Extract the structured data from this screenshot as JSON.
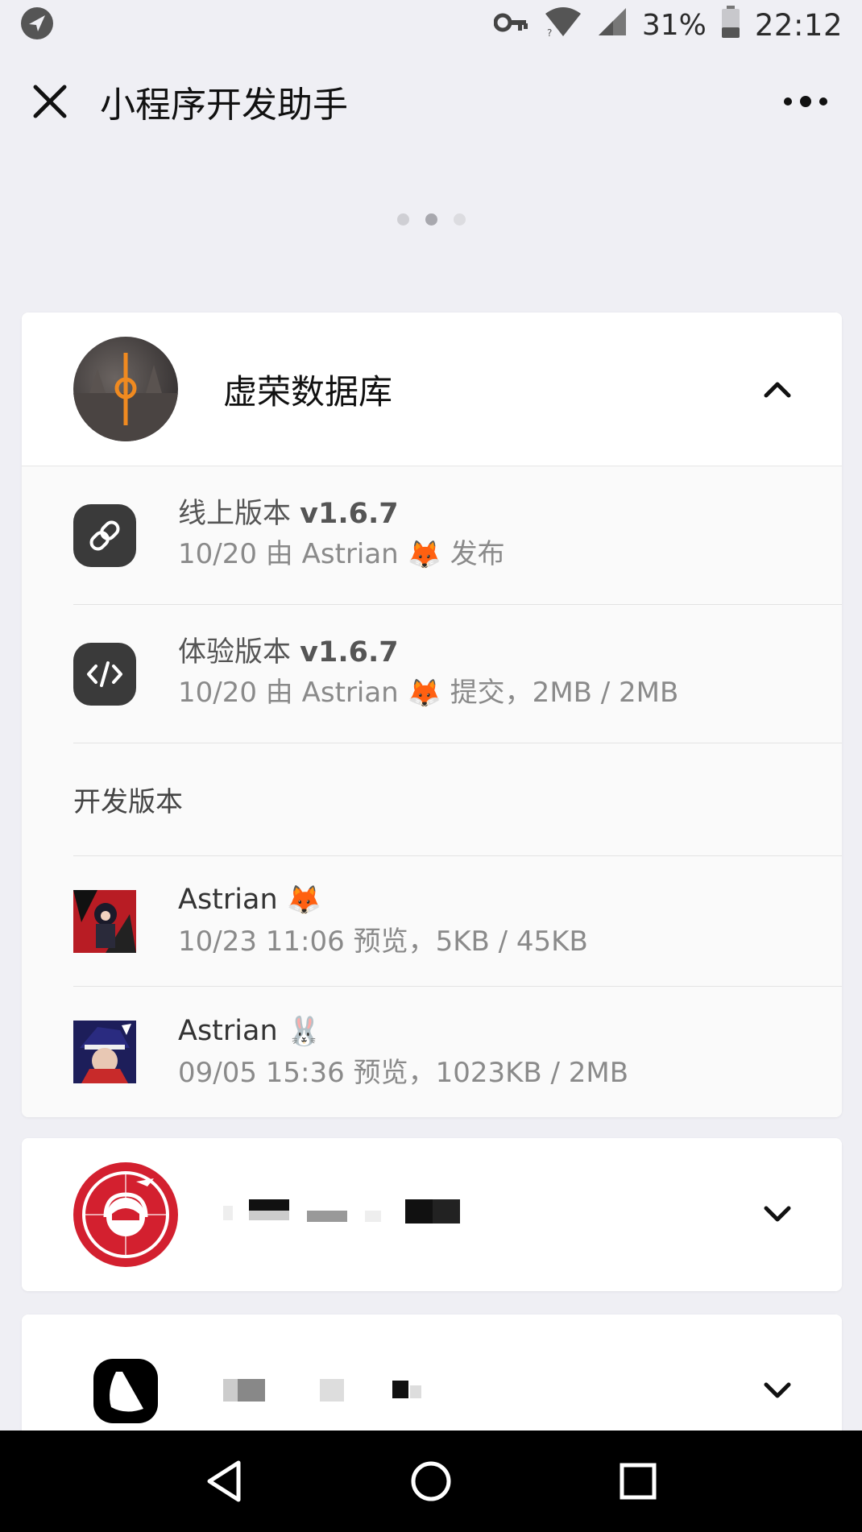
{
  "status_bar": {
    "battery_percent": "31%",
    "time": "22:12",
    "icons": [
      "navigation-icon",
      "key-icon",
      "wifi-icon",
      "signal-icon",
      "battery-icon"
    ]
  },
  "header": {
    "title": "小程序开发助手",
    "close_icon": "close-icon",
    "more_icon": "more-icon"
  },
  "pager": {
    "count": 3,
    "active_index": 1
  },
  "apps": [
    {
      "name": "虚荣数据库",
      "expanded": true,
      "chevron": "chevron-up-icon",
      "online_version": {
        "label": "线上版本",
        "version": "v1.6.7",
        "detail_prefix": "10/20 由 Astrian",
        "emoji": "🦊",
        "detail_suffix": "发布",
        "icon": "link-icon"
      },
      "trial_version": {
        "label": "体验版本",
        "version": "v1.6.7",
        "detail_prefix": "10/20 由 Astrian",
        "emoji": "🦊",
        "detail_suffix": "提交，2MB / 2MB",
        "icon": "code-icon"
      },
      "dev_section_label": "开发版本",
      "dev_versions": [
        {
          "name": "Astrian",
          "emoji": "🦊",
          "detail": "10/23 11:06 预览，5KB / 45KB"
        },
        {
          "name": "Astrian",
          "emoji": "🐰",
          "detail": "09/05 15:36 预览，1023KB / 2MB"
        }
      ]
    },
    {
      "expanded": false,
      "chevron": "chevron-down-icon"
    },
    {
      "expanded": false,
      "chevron": "chevron-down-icon"
    }
  ],
  "bottom_nav": {
    "icons": [
      "back-triangle-icon",
      "home-circle-icon",
      "recents-square-icon"
    ]
  },
  "colors": {
    "background": "#efeff4",
    "card": "#ffffff",
    "accent_red": "#d3202f",
    "icon_dark": "#3a3a3a"
  }
}
